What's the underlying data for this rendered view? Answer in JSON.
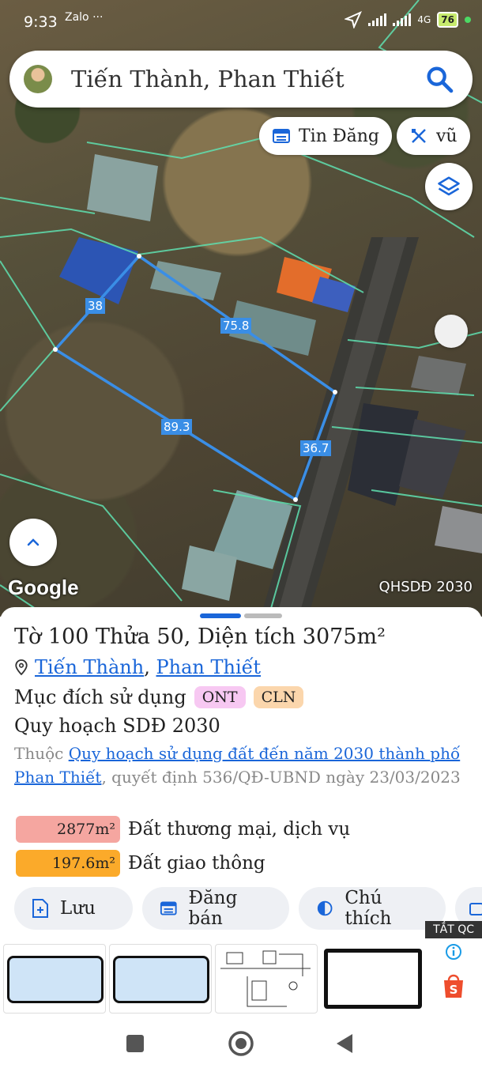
{
  "status_bar": {
    "time": "9:33",
    "apps": "Zalo ···",
    "network": "4G",
    "battery": "76"
  },
  "search": {
    "value": "Tiến Thành, Phan Thiết"
  },
  "chips": {
    "listings": "Tin Đăng",
    "draw": "vũ"
  },
  "map": {
    "dimensions": [
      "38",
      "75.8",
      "89.3",
      "36.7"
    ],
    "google_logo": "Google",
    "layer_label": "QHSDĐ 2030"
  },
  "parcel": {
    "title": "Tờ 100 Thửa 50, Diện tích 3075m²",
    "commune": "Tiến Thành",
    "city": "Phan Thiết",
    "purpose_label": "Mục đích sử dụng",
    "purpose_tags": [
      "ONT",
      "CLN"
    ],
    "plan_title": "Quy hoạch SDĐ 2030",
    "plan_prefix": "Thuộc ",
    "plan_link": "Quy hoạch sử dụng đất đến năm 2030 thành phố Phan Thiết",
    "plan_suffix": ", quyết định 536/QĐ-UBND ngày 23/03/2023",
    "zones": [
      {
        "area": "2877m²",
        "label": "Đất thương mại, dịch vụ",
        "color": "#f5a6a0"
      },
      {
        "area": "197.6m²",
        "label": "Đất giao thông",
        "color": "#fbaa2a"
      }
    ]
  },
  "actions": {
    "save": "Lưu",
    "post": "Đăng bán",
    "legend": "Chú thích"
  },
  "ad": {
    "close": "TẮT QC"
  },
  "colors": {
    "accent": "#1a66d9",
    "parcel_line": "#3a8ee6",
    "ont_bg": "#f7c8f2",
    "cln_bg": "#fbd6ac"
  }
}
